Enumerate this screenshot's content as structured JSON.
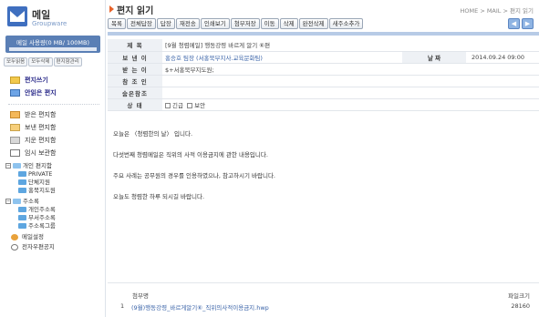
{
  "sidebar": {
    "logo": {
      "name": "메일",
      "sub": "Groupware"
    },
    "usage_text": "메일 사용량(0 MB/ 100MB)",
    "usage_fraction": 0.0,
    "small_buttons": [
      "모두읽음",
      "모두삭제",
      "편지함관리"
    ],
    "menu": [
      {
        "label": "편지쓰기",
        "icon": "write-icon",
        "bold": true
      },
      {
        "label": "안읽은 편지",
        "icon": "send-icon",
        "bold": true
      },
      {
        "label": "받은 편지함",
        "icon": "inbox-icon",
        "bold": false
      },
      {
        "label": "보낸 편지함",
        "icon": "sent-icon",
        "bold": false
      },
      {
        "label": "지운 편지함",
        "icon": "trash-icon",
        "bold": false
      },
      {
        "label": "임시 보관함",
        "icon": "drafts-icon",
        "bold": false
      }
    ],
    "tree": {
      "personal": "개인 편지함",
      "personal_children": [
        "PRIVATE",
        "단체지원",
        "홍북지도원"
      ],
      "address": "주소록",
      "address_children": [
        "개인주소록",
        "부서주소록",
        "주소록그룹"
      ]
    },
    "settings": [
      "메일설정",
      "전자우편공지"
    ]
  },
  "main": {
    "title": "편지 읽기",
    "breadcrumb": "HOME > MAIL > 편지 읽기",
    "toolbar": [
      "목록",
      "전체답장",
      "답장",
      "재전송",
      "인쇄보기",
      "첨부저장",
      "이동",
      "삭제",
      "완전삭제",
      "새주소추가"
    ],
    "arrows": {
      "prev": "◀",
      "next": "▶"
    },
    "header": {
      "subject_label": "제 목",
      "subject": "[9월 청렴메일] 행동강령 바르게 알기 ⑥편",
      "from_label": "보 낸 이",
      "from": "홍승호 팀장 (서홍북부지사.교육문화팀)",
      "date_label": "날 짜",
      "date": "2014.09.24 09:00",
      "to_label": "받 는 이",
      "to": "$+서홍북부지도원;",
      "cc_label": "참 조 인",
      "cc": "",
      "bcc_label": "숨은참조",
      "bcc": "",
      "status_label": "상 태",
      "status_options": [
        "긴급",
        "보안"
      ]
    },
    "body": [
      "오늘은 〈청렴한의 날〉 입니다.",
      "다섯번째 청렴메일은 직위의 사적 이용금지에 관한 내용입니다.",
      "주요 사례는 공무원의 경우를 인용하였으나, 참고하시기 바랍니다.",
      "오늘도 청렴한 하루 되시길 바랍니다."
    ],
    "attachments": {
      "name_header": "첨부명",
      "size_header": "파일크기",
      "items": [
        {
          "num": "1",
          "name": "(9월)행동강령_바르게알기⑥_직위의사적이용금지.hwp",
          "size": "28160"
        }
      ]
    }
  }
}
